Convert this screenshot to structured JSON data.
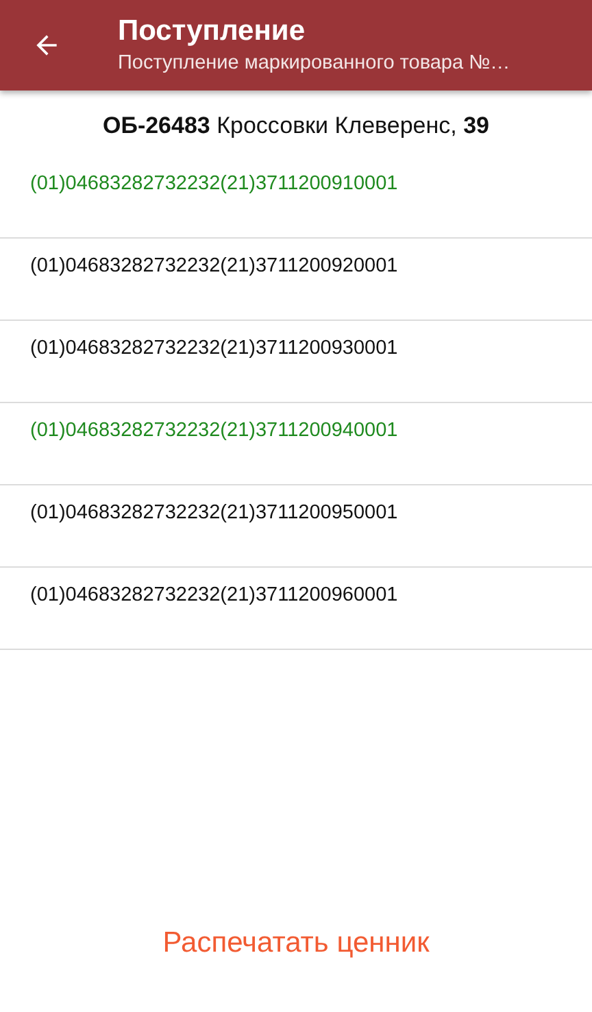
{
  "app_bar": {
    "title": "Поступление",
    "subtitle": "Поступление маркированного товара №…"
  },
  "product": {
    "title": "**ОБ-26483** Кроссовки Клеверенс, **39**"
  },
  "codes": [
    {
      "text": "(01)04683282732232(21)3711200910001",
      "scanned": true
    },
    {
      "text": "(01)04683282732232(21)3711200920001",
      "scanned": false
    },
    {
      "text": "(01)04683282732232(21)3711200930001",
      "scanned": false
    },
    {
      "text": "(01)04683282732232(21)3711200940001",
      "scanned": true
    },
    {
      "text": "(01)04683282732232(21)3711200950001",
      "scanned": false
    },
    {
      "text": "(01)04683282732232(21)3711200960001",
      "scanned": false
    }
  ],
  "action_button": {
    "label": "Распечатать ценник"
  }
}
